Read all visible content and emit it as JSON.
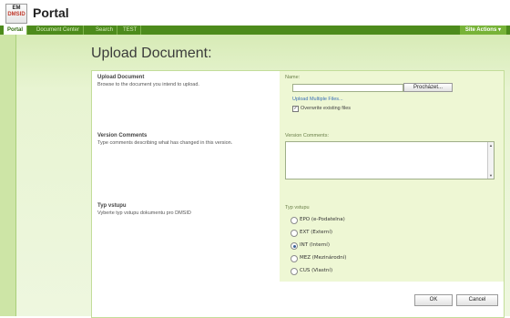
{
  "header": {
    "logo_top": "EM",
    "logo_bottom": "DMSID",
    "title": "Portal"
  },
  "nav": {
    "tabs": [
      {
        "label": "Portal"
      },
      {
        "label": "Document Center"
      },
      {
        "label": "Search"
      },
      {
        "label": "TEST"
      }
    ],
    "site_actions": "Site Actions"
  },
  "page": {
    "title": "Upload Document:"
  },
  "upload_section": {
    "title": "Upload Document",
    "description": "Browse to the document you intend to upload.",
    "name_label": "Name:",
    "name_value": "",
    "browse_button": "Procházet...",
    "multiple_link": "Upload Multiple Files...",
    "overwrite_label": "Overwrite existing files",
    "overwrite_checked": true
  },
  "version_section": {
    "title": "Version Comments",
    "description": "Type comments describing what has changed in this version.",
    "comments_label": "Version Comments:",
    "comments_value": ""
  },
  "type_section": {
    "title": "Typ vstupu",
    "description": "Vyberte typ vstupu dokumentu pro DMSID",
    "field_label": "Typ vstupu",
    "options": [
      {
        "label": "EPO (e-Podatelna)",
        "selected": false
      },
      {
        "label": "EXT (Externí)",
        "selected": false
      },
      {
        "label": "INT (Interní)",
        "selected": true
      },
      {
        "label": "MEZ (Mezinárodní)",
        "selected": false
      },
      {
        "label": "CUS (Vlastní)",
        "selected": false
      }
    ]
  },
  "footer": {
    "ok": "OK",
    "cancel": "Cancel"
  },
  "colors": {
    "nav_green": "#4d8b1c",
    "panel_right_bg": "#eef7d4"
  }
}
